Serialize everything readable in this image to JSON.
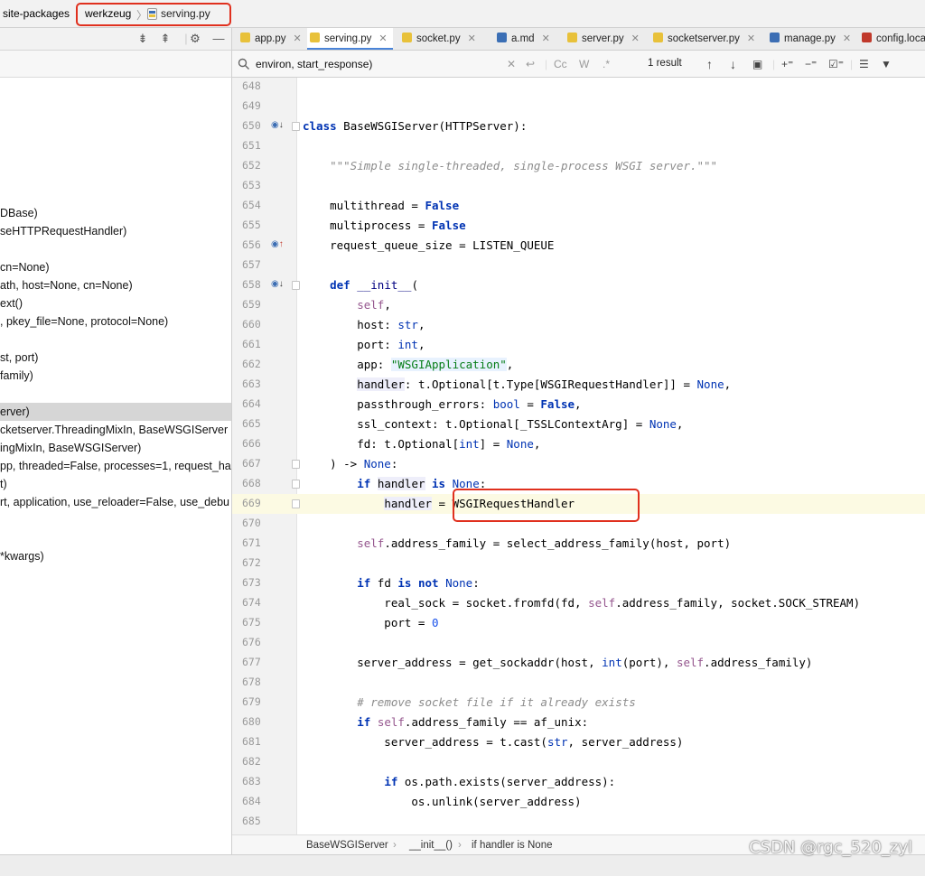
{
  "navbar": {
    "crumbs": [
      "site-packages",
      "werkzeug",
      "serving.py"
    ],
    "separator": "〉"
  },
  "left_panel": {
    "rows": [
      {
        "text": "DBase)",
        "selected": false
      },
      {
        "text": "seHTTPRequestHandler)",
        "selected": false
      },
      {
        "text": "",
        "selected": false
      },
      {
        "text": "cn=None)",
        "selected": false
      },
      {
        "text": "ath, host=None, cn=None)",
        "selected": false
      },
      {
        "text": "ext()",
        "selected": false
      },
      {
        "text": ", pkey_file=None, protocol=None)",
        "selected": false
      },
      {
        "text": "",
        "selected": false
      },
      {
        "text": "st, port)",
        "selected": false
      },
      {
        "text": "family)",
        "selected": false
      },
      {
        "text": "",
        "selected": false
      },
      {
        "text": "erver)",
        "selected": true
      },
      {
        "text": "cketserver.ThreadingMixIn, BaseWSGIServer",
        "selected": false
      },
      {
        "text": "ingMixIn, BaseWSGIServer)",
        "selected": false
      },
      {
        "text": "pp, threaded=False, processes=1, request_ha",
        "selected": false
      },
      {
        "text": "t)",
        "selected": false
      },
      {
        "text": "rt, application, use_reloader=False, use_debu",
        "selected": false
      },
      {
        "text": "",
        "selected": false
      },
      {
        "text": "",
        "selected": false
      },
      {
        "text": "*kwargs)",
        "selected": false
      }
    ]
  },
  "tabs": [
    {
      "label": "app.py",
      "active": false,
      "icon_color": "#e8c13a"
    },
    {
      "label": "serving.py",
      "active": true,
      "icon_color": "#e8c13a"
    },
    {
      "label": "socket.py",
      "active": false,
      "icon_color": "#e8c13a"
    },
    {
      "label": "a.md",
      "active": false,
      "icon_color": "#3b6fb5",
      "icon_text": "MD"
    },
    {
      "label": "server.py",
      "active": false,
      "icon_color": "#e8c13a"
    },
    {
      "label": "socketserver.py",
      "active": false,
      "icon_color": "#e8c13a"
    },
    {
      "label": "manage.py",
      "active": false,
      "icon_color": "#3c6eb4"
    },
    {
      "label": "config.loca",
      "active": false,
      "icon_color": "#c0392b",
      "icon_text": "YML"
    }
  ],
  "search": {
    "query": "environ, start_response)",
    "result": "1 result",
    "match_case": "Cc",
    "words": "W",
    "regex": ".*"
  },
  "code_lines": [
    {
      "n": "648",
      "html": ""
    },
    {
      "n": "649",
      "html": ""
    },
    {
      "n": "650",
      "html": "<span class=\"kw\">class</span> BaseWSGIServer(HTTPServer):",
      "mark": "◉↓"
    },
    {
      "n": "651",
      "html": ""
    },
    {
      "n": "652",
      "html": "    <span class=\"doc\">\"\"\"Simple single-threaded, single-process WSGI server.\"\"\"</span>"
    },
    {
      "n": "653",
      "html": ""
    },
    {
      "n": "654",
      "html": "    multithread = <span class=\"kw\">False</span>"
    },
    {
      "n": "655",
      "html": "    multiprocess = <span class=\"kw\">False</span>"
    },
    {
      "n": "656",
      "html": "    request_queue_size = LISTEN_QUEUE",
      "mark": "◉↑"
    },
    {
      "n": "657",
      "html": ""
    },
    {
      "n": "658",
      "html": "    <span class=\"kw\">def</span> <span class=\"bi\">__init__</span>(",
      "mark": "◉↓"
    },
    {
      "n": "659",
      "html": "        <span class=\"slf\">self</span>,"
    },
    {
      "n": "660",
      "html": "        host: <span class=\"kwn\">str</span>,"
    },
    {
      "n": "661",
      "html": "        port: <span class=\"kwn\">int</span>,"
    },
    {
      "n": "662",
      "html": "        app: <span class=\"strhl\">\"WSGIApplication\"</span>,"
    },
    {
      "n": "663",
      "html": "        <span class=\"hlbox\">handler</span>: t.Optional[t.Type[WSGIRequestHandler]] = <span class=\"kwn\">None</span>,"
    },
    {
      "n": "664",
      "html": "        passthrough_errors: <span class=\"kwn\">bool</span> = <span class=\"kw\">False</span>,"
    },
    {
      "n": "665",
      "html": "        ssl_context: t.Optional[_TSSLContextArg] = <span class=\"kwn\">None</span>,"
    },
    {
      "n": "666",
      "html": "        fd: t.Optional[<span class=\"kwn\">int</span>] = <span class=\"kwn\">None</span>,"
    },
    {
      "n": "667",
      "html": "    ) -> <span class=\"kwn\">None</span>:"
    },
    {
      "n": "668",
      "html": "        <span class=\"kw\">if</span> <span class=\"hlbox\">handler</span> <span class=\"kw\">is</span> <span class=\"kwn\">None</span>:"
    },
    {
      "n": "669",
      "html": "            <span class=\"hlbox\">handler</span> = WSGIRequestHandler",
      "current": true
    },
    {
      "n": "670",
      "html": ""
    },
    {
      "n": "671",
      "html": "        <span class=\"slf\">self</span>.address_family = select_address_family(host, port)"
    },
    {
      "n": "672",
      "html": ""
    },
    {
      "n": "673",
      "html": "        <span class=\"kw\">if</span> fd <span class=\"kw\">is not</span> <span class=\"kwn\">None</span>:"
    },
    {
      "n": "674",
      "html": "            real_sock = socket.fromfd(fd, <span class=\"slf\">self</span>.address_family, socket.SOCK_STREAM)"
    },
    {
      "n": "675",
      "html": "            port = <span class=\"num\">0</span>"
    },
    {
      "n": "676",
      "html": ""
    },
    {
      "n": "677",
      "html": "        server_address = get_sockaddr(host, <span class=\"kwn\">int</span>(port), <span class=\"slf\">self</span>.address_family)"
    },
    {
      "n": "678",
      "html": ""
    },
    {
      "n": "679",
      "html": "        <span class=\"cmt\"># remove socket file if it already exists</span>"
    },
    {
      "n": "680",
      "html": "        <span class=\"kw\">if</span> <span class=\"slf\">self</span>.address_family == af_unix:"
    },
    {
      "n": "681",
      "html": "            server_address = t.cast(<span class=\"kwn\">str</span>, server_address)"
    },
    {
      "n": "682",
      "html": ""
    },
    {
      "n": "683",
      "html": "            <span class=\"kw\">if</span> os.path.exists(server_address):"
    },
    {
      "n": "684",
      "html": "                os.unlink(server_address)"
    },
    {
      "n": "685",
      "html": ""
    }
  ],
  "editor_crumbs": [
    "BaseWSGIServer",
    "›",
    "__init__()",
    "›",
    "if handler is None"
  ],
  "watermark": "CSDN @rgc_520_zyl",
  "colors": {
    "accent_tab": "#4a84d8",
    "highlight_box": "#e0301e",
    "keyword": "#0033b3",
    "self": "#94558d"
  }
}
